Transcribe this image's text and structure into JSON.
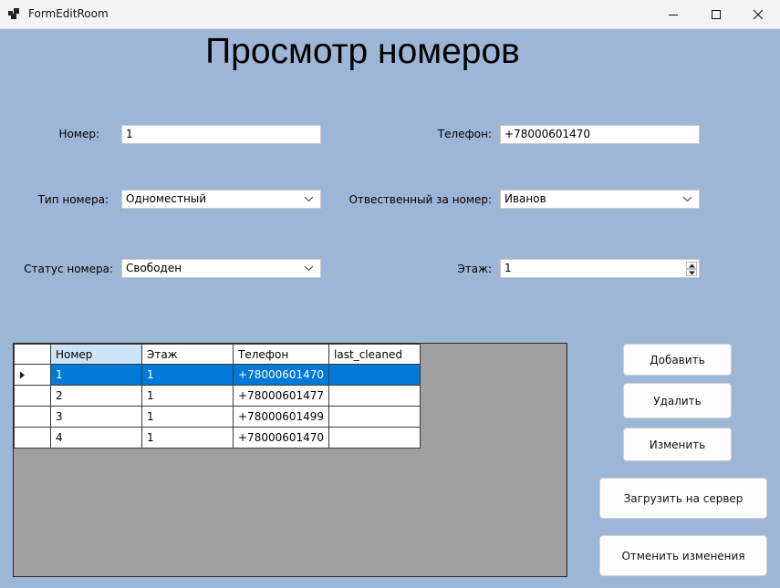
{
  "window": {
    "title": "FormEditRoom"
  },
  "heading": "Просмотр номеров",
  "form": {
    "room_label": "Номер:",
    "room_value": "1",
    "phone_label": "Телефон:",
    "phone_value": "+78000601470",
    "type_label": "Тип номера:",
    "type_value": "Одноместный",
    "responsible_label": "Отвественный за номер:",
    "responsible_value": "Иванов",
    "status_label": "Статус номера:",
    "status_value": "Свободен",
    "floor_label": "Этаж:",
    "floor_value": "1"
  },
  "grid": {
    "columns": [
      "Номер",
      "Этаж",
      "Телефон",
      "last_cleaned"
    ],
    "rows": [
      [
        "1",
        "1",
        "+78000601470",
        ""
      ],
      [
        "2",
        "1",
        "+78000601477",
        ""
      ],
      [
        "3",
        "1",
        "+78000601499",
        ""
      ],
      [
        "4",
        "1",
        "+78000601470",
        ""
      ]
    ],
    "selected_row": 0
  },
  "buttons": {
    "add": "Добавить",
    "delete": "Удалить",
    "edit": "Изменить",
    "upload": "Загрузить на сервер",
    "cancel": "Отменить изменения"
  },
  "colors": {
    "form_bg": "#9eb6d5",
    "selection": "#0078d7",
    "grid_bg": "#a0a0a0"
  }
}
